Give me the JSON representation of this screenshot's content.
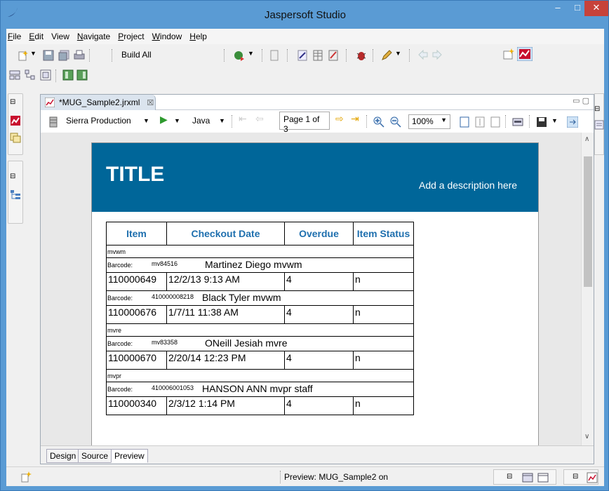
{
  "window": {
    "title": "Jaspersoft Studio",
    "minimize": "–",
    "maximize": "□",
    "close": "✕"
  },
  "menu": [
    {
      "label": "File",
      "mnemonic_first": "F",
      "rest": "ile"
    },
    {
      "label": "Edit",
      "mnemonic_first": "E",
      "rest": "dit"
    },
    {
      "label": "View",
      "mnemonic_first": "",
      "rest": "View"
    },
    {
      "label": "Navigate",
      "mnemonic_first": "N",
      "rest": "avigate"
    },
    {
      "label": "Project",
      "mnemonic_first": "P",
      "rest": "roject"
    },
    {
      "label": "Window",
      "mnemonic_first": "W",
      "rest": "indow"
    },
    {
      "label": "Help",
      "mnemonic_first": "H",
      "rest": "elp"
    }
  ],
  "toolbar": {
    "build_all": "Build All"
  },
  "editor": {
    "tab_label": "*MUG_Sample2.jrxml",
    "tab_close": "☒",
    "adapter": "Sierra Production",
    "language": "Java",
    "page_indicator": "Page 1 of 3",
    "zoom": "100%"
  },
  "report": {
    "title": "TITLE",
    "description": "Add a description here",
    "columns": [
      "Item",
      "Checkout Date",
      "Overdue",
      "Item Status"
    ],
    "barcode_label": "Barcode:",
    "groups": [
      {
        "group": "mvwm",
        "code": "mv84516",
        "name": "Martinez Diego mvwm",
        "item": "110000649",
        "date": "12/2/13 9:13 AM",
        "overdue": "4",
        "status": "n"
      },
      {
        "group": "",
        "code": "410000008218",
        "name": "Black Tyler mvwm",
        "item": "110000676",
        "date": "1/7/11 11:38 AM",
        "overdue": "4",
        "status": "n"
      },
      {
        "group": "mvre",
        "code": "mv83358",
        "name": "ONeill Jesiah mvre",
        "item": "110000670",
        "date": "2/20/14 12:23 PM",
        "overdue": "4",
        "status": "n"
      },
      {
        "group": "mvpr",
        "code": "410006001053",
        "name": "HANSON ANN mvpr staff",
        "item": "110000340",
        "date": "2/3/12 1:14 PM",
        "overdue": "4",
        "status": "n"
      }
    ]
  },
  "bottom_tabs": [
    "Design",
    "Source",
    "Preview"
  ],
  "active_bottom_tab": "Preview",
  "status": {
    "text": "Preview: MUG_Sample2 on"
  },
  "colors": {
    "header_band": "#006699",
    "column_header": "#1e6fae",
    "window_frame": "#5a9bd4"
  }
}
